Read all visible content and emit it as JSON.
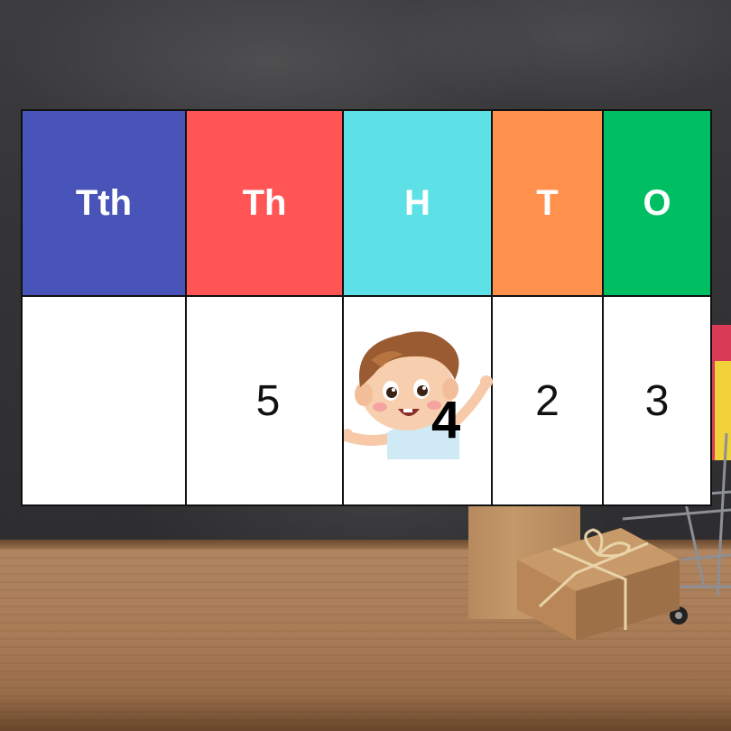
{
  "place_value_chart": {
    "headers": [
      {
        "label": "Tth",
        "color": "#4854b8"
      },
      {
        "label": "Th",
        "color": "#ff5555"
      },
      {
        "label": "H",
        "color": "#5de0e6"
      },
      {
        "label": "T",
        "color": "#ff914d"
      },
      {
        "label": "O",
        "color": "#00bf63"
      }
    ],
    "values": [
      "",
      "5",
      "4",
      "2",
      "3"
    ]
  },
  "scene": {
    "background": "chalkboard",
    "surface": "wooden desk",
    "character": "cartoon-boy-waving"
  }
}
